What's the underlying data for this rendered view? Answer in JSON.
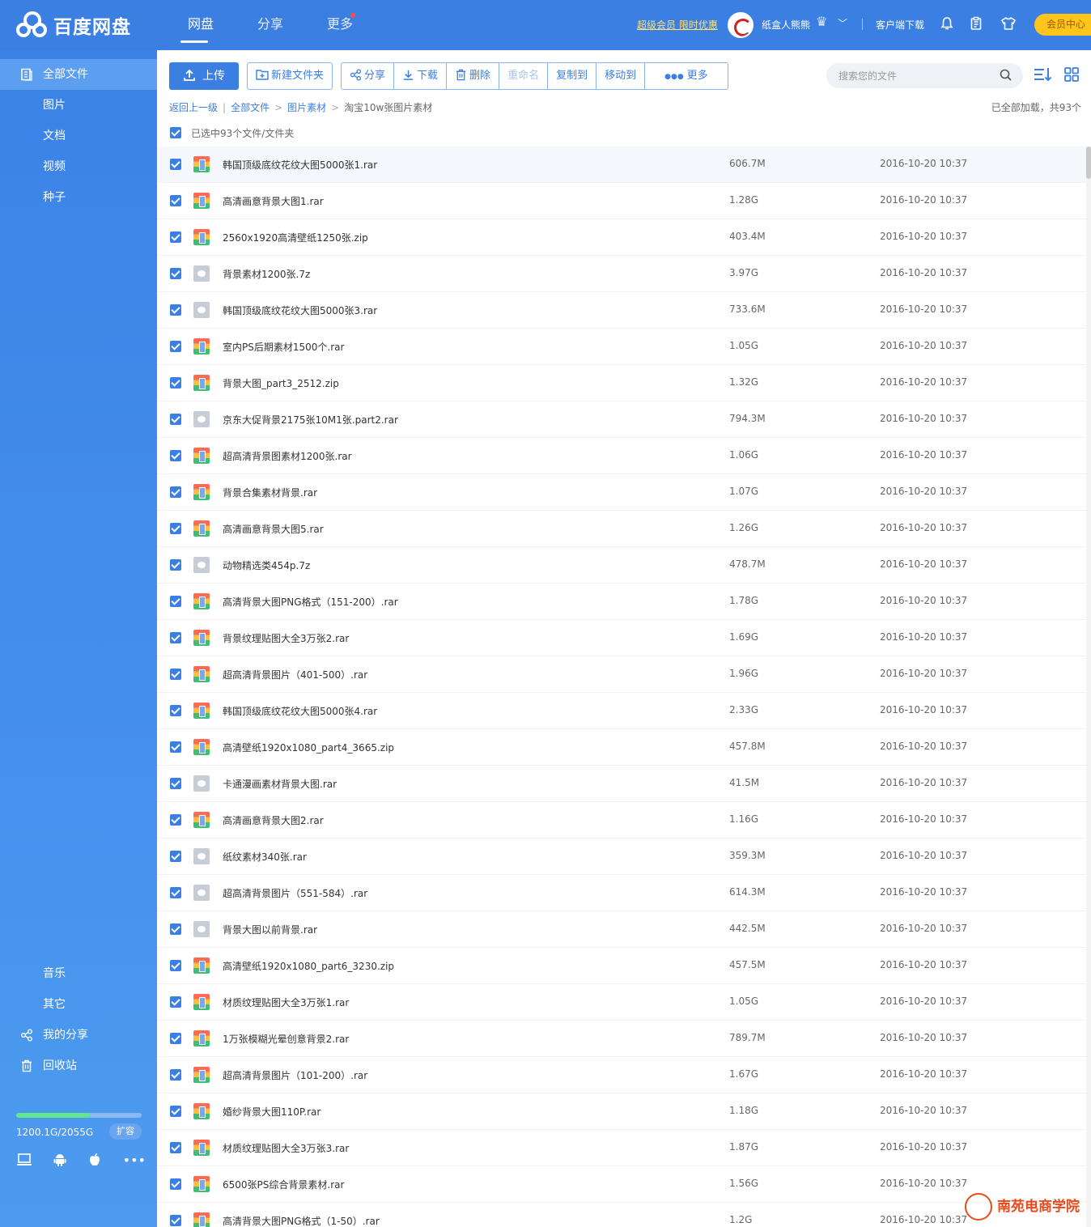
{
  "app": {
    "name": "百度网盘"
  },
  "topnav": [
    {
      "label": "网盘",
      "active": true
    },
    {
      "label": "分享",
      "active": false
    },
    {
      "label": "更多",
      "active": false,
      "badge": true
    }
  ],
  "header": {
    "promo": "超级会员 限时优惠",
    "username": "纸盒人熊熊",
    "client_download": "客户端下载",
    "vip_center": "会员中心"
  },
  "sidebar": {
    "items": [
      {
        "label": "全部文件",
        "icon": "file-icon",
        "active": true
      },
      {
        "label": "图片"
      },
      {
        "label": "文档"
      },
      {
        "label": "视频"
      },
      {
        "label": "种子"
      },
      {
        "label": "音乐"
      },
      {
        "label": "其它"
      },
      {
        "label": "我的分享",
        "icon": "share-icon"
      },
      {
        "label": "回收站",
        "icon": "trash-icon"
      }
    ],
    "quota": {
      "text": "1200.1G/2055G",
      "used_fraction": 0.584,
      "expand_label": "扩容"
    }
  },
  "toolbar": {
    "upload": "上传",
    "new_folder": "新建文件夹",
    "share": "分享",
    "download": "下载",
    "delete": "删除",
    "rename": "重命名",
    "copy_to": "复制到",
    "move_to": "移动到",
    "more": "更多"
  },
  "search": {
    "placeholder": "搜索您的文件"
  },
  "breadcrumb": {
    "back": "返回上一级",
    "items": [
      "全部文件",
      "图片素材"
    ],
    "current": "淘宝10w张图片素材"
  },
  "status": {
    "loaded": "已全部加载，共93个",
    "selected": "已选中93个文件/文件夹"
  },
  "files": [
    {
      "name": "韩国顶级底纹花纹大图5000张1.rar",
      "size": "606.7M",
      "date": "2016-10-20 10:37",
      "type": "archive"
    },
    {
      "name": "高清画意背景大图1.rar",
      "size": "1.28G",
      "date": "2016-10-20 10:37",
      "type": "archive"
    },
    {
      "name": "2560x1920高清壁纸1250张.zip",
      "size": "403.4M",
      "date": "2016-10-20 10:37",
      "type": "archive"
    },
    {
      "name": "背景素材1200张.7z",
      "size": "3.97G",
      "date": "2016-10-20 10:37",
      "type": "other"
    },
    {
      "name": "韩国顶级底纹花纹大图5000张3.rar",
      "size": "733.6M",
      "date": "2016-10-20 10:37",
      "type": "other"
    },
    {
      "name": "室内PS后期素材1500个.rar",
      "size": "1.05G",
      "date": "2016-10-20 10:37",
      "type": "archive"
    },
    {
      "name": "背景大图_part3_2512.zip",
      "size": "1.32G",
      "date": "2016-10-20 10:37",
      "type": "archive"
    },
    {
      "name": "京东大促背景2175张10M1张.part2.rar",
      "size": "794.3M",
      "date": "2016-10-20 10:37",
      "type": "other"
    },
    {
      "name": "超高清背景图素材1200张.rar",
      "size": "1.06G",
      "date": "2016-10-20 10:37",
      "type": "archive"
    },
    {
      "name": "背景合集素材背景.rar",
      "size": "1.07G",
      "date": "2016-10-20 10:37",
      "type": "archive"
    },
    {
      "name": "高清画意背景大图5.rar",
      "size": "1.26G",
      "date": "2016-10-20 10:37",
      "type": "archive"
    },
    {
      "name": "动物精选类454p.7z",
      "size": "478.7M",
      "date": "2016-10-20 10:37",
      "type": "other"
    },
    {
      "name": "高清背景大图PNG格式（151-200）.rar",
      "size": "1.78G",
      "date": "2016-10-20 10:37",
      "type": "archive"
    },
    {
      "name": "背景纹理贴图大全3万张2.rar",
      "size": "1.69G",
      "date": "2016-10-20 10:37",
      "type": "archive"
    },
    {
      "name": "超高清背景图片（401-500）.rar",
      "size": "1.96G",
      "date": "2016-10-20 10:37",
      "type": "archive"
    },
    {
      "name": "韩国顶级底纹花纹大图5000张4.rar",
      "size": "2.33G",
      "date": "2016-10-20 10:37",
      "type": "archive"
    },
    {
      "name": "高清壁纸1920x1080_part4_3665.zip",
      "size": "457.8M",
      "date": "2016-10-20 10:37",
      "type": "archive"
    },
    {
      "name": "卡通漫画素材背景大图.rar",
      "size": "41.5M",
      "date": "2016-10-20 10:37",
      "type": "other"
    },
    {
      "name": "高清画意背景大图2.rar",
      "size": "1.16G",
      "date": "2016-10-20 10:37",
      "type": "archive"
    },
    {
      "name": "纸纹素材340张.rar",
      "size": "359.3M",
      "date": "2016-10-20 10:37",
      "type": "other"
    },
    {
      "name": "超高清背景图片（551-584）.rar",
      "size": "614.3M",
      "date": "2016-10-20 10:37",
      "type": "other"
    },
    {
      "name": "背景大图以前背景.rar",
      "size": "442.5M",
      "date": "2016-10-20 10:37",
      "type": "other"
    },
    {
      "name": "高清壁纸1920x1080_part6_3230.zip",
      "size": "457.5M",
      "date": "2016-10-20 10:37",
      "type": "archive"
    },
    {
      "name": "材质纹理贴图大全3万张1.rar",
      "size": "1.05G",
      "date": "2016-10-20 10:37",
      "type": "archive"
    },
    {
      "name": "1万张模糊光晕创意背景2.rar",
      "size": "789.7M",
      "date": "2016-10-20 10:37",
      "type": "archive"
    },
    {
      "name": "超高清背景图片（101-200）.rar",
      "size": "1.67G",
      "date": "2016-10-20 10:37",
      "type": "archive"
    },
    {
      "name": "婚纱背景大图110P.rar",
      "size": "1.18G",
      "date": "2016-10-20 10:37",
      "type": "archive"
    },
    {
      "name": "材质纹理贴图大全3万张3.rar",
      "size": "1.87G",
      "date": "2016-10-20 10:37",
      "type": "archive"
    },
    {
      "name": "6500张PS综合背景素材.rar",
      "size": "1.56G",
      "date": "2016-10-20 10:37",
      "type": "archive"
    },
    {
      "name": "高清背景大图PNG格式（1-50）.rar",
      "size": "1.2G",
      "date": "2016-10-20 10:37",
      "type": "archive"
    }
  ],
  "watermark": {
    "text": "南苑电商学院"
  },
  "colors": {
    "brand": "#3b7fe3",
    "vip": "#ffc51a",
    "promo": "#ffe27a",
    "quota": "#61e68e"
  }
}
